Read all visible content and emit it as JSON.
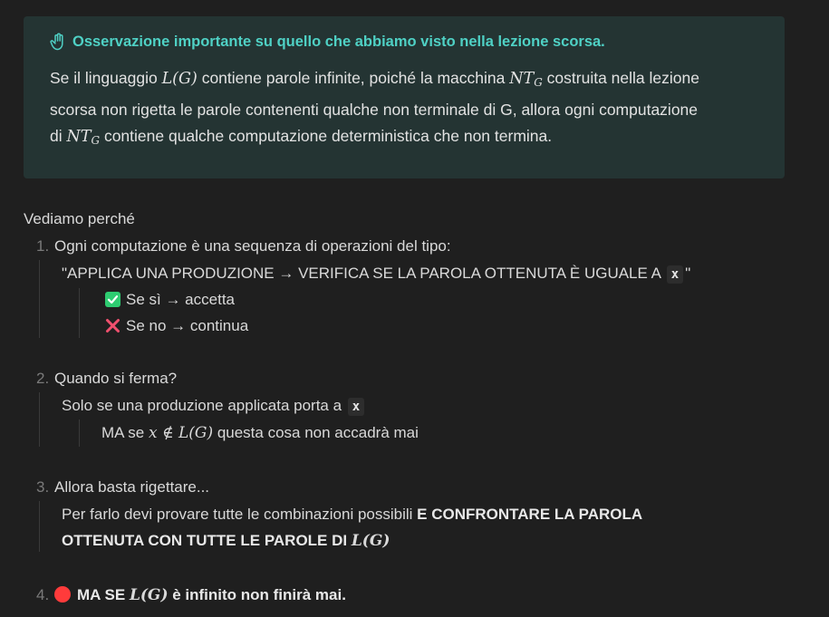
{
  "callout": {
    "title": "Osservazione importante su quello che abbiamo visto nella lezione scorsa.",
    "icon": "raised-hand-icon",
    "body_part1": "Se il linguaggio ",
    "lg": "L(G)",
    "body_part2": " contiene parole infinite, poiché la macchina ",
    "nt": "NT",
    "nt_sub": "G",
    "body_part3": " costruita nella lezione",
    "body_line2": "scorsa non rigetta le parole contenenti qualche non terminale di G, allora ogni computazione",
    "body_line3_a": "di ",
    "body_line3_b": " contiene qualche computazione deterministica che non termina."
  },
  "lead": "Vediamo perché",
  "items": [
    {
      "num": "1.",
      "text": "Ogni computazione è una sequenza di operazioni del tipo:",
      "quote_a": "\"APPLICA UNA PRODUZIONE → VERIFICA SE LA PAROLA OTTENUTA È UGUALE A",
      "quote_code": "x",
      "quote_b": "\"",
      "yes": "Se sì → accetta",
      "no": "Se no → continua"
    },
    {
      "num": "2.",
      "text": "Quando si ferma?",
      "line1": "Solo se una produzione applicata porta a",
      "code": "x",
      "line2_a": "MA se ",
      "math": "x ∉ L(G)",
      "line2_b": " questa cosa non accadrà mai"
    },
    {
      "num": "3.",
      "text": "Allora basta rigettare...",
      "line1_a": "Per farlo devi provare tutte le combinazioni possibili ",
      "line1_b": "E CONFRONTARE LA PAROLA",
      "line2": "OTTENUTA CON TUTTE LE PAROLE DI ",
      "line2_math": "L(G)"
    },
    {
      "num": "4.",
      "text_a": "MA SE ",
      "math": "L(G)",
      "text_b": " è infinito non finirà mai."
    }
  ],
  "colors": {
    "accent": "#4fd1c5",
    "callout_bg": "#243433",
    "check": "#2ecc71",
    "cross": "#f0506e",
    "dot": "#ff3b3b"
  }
}
